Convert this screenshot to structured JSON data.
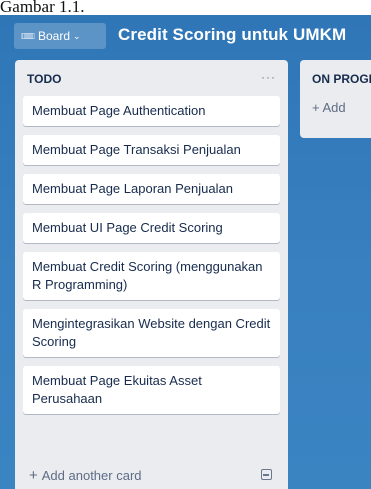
{
  "caption": "Gambar 1.1.",
  "header": {
    "board_switch_label": "Board",
    "board_title": "Credit Scoring untuk UMKM"
  },
  "lists": [
    {
      "title": "TODO",
      "menu": "···",
      "cards": [
        "Membuat Page Authentication",
        "Membuat Page Transaksi Penjualan",
        "Membuat Page Laporan Penjualan",
        "Membuat UI Page Credit Scoring",
        "Membuat Credit Scoring (menggunakan R Programming)",
        "Mengintegrasikan Website dengan Credit Scoring",
        "Membuat Page Ekuitas Asset Perusahaan"
      ],
      "add_card_label": "Add another card"
    },
    {
      "title": "ON PROGRESS",
      "add_card_label": "Add"
    }
  ],
  "icons": {
    "boards": "boards-icon",
    "chevron": "chevron-down-icon",
    "plus": "plus-icon",
    "template": "card-template-icon"
  },
  "colors": {
    "board_background": "#3179ba",
    "list_background": "#ebecf0",
    "card_text": "#172b4d"
  }
}
